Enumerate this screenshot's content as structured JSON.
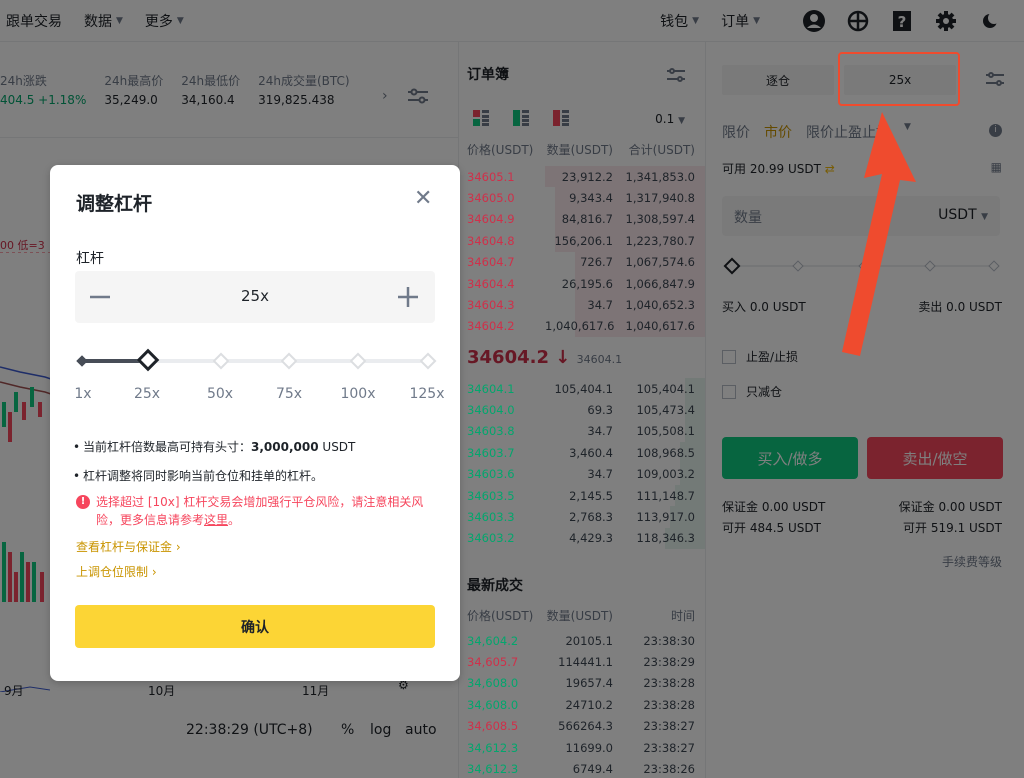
{
  "nav": {
    "left": [
      "跟单交易",
      "数据",
      "更多"
    ],
    "right": [
      "钱包",
      "订单"
    ]
  },
  "ticker": {
    "items": [
      {
        "label": "24h涨跌",
        "value": "404.5 +1.18%"
      },
      {
        "label": "24h最高价",
        "value": "35,249.0"
      },
      {
        "label": "24h最低价",
        "value": "34,160.4"
      },
      {
        "label": "24h成交量(BTC)",
        "value": "319,825.438"
      }
    ]
  },
  "chart": {
    "months": [
      "9月",
      "10月",
      "11月"
    ],
    "time": "22:38:29 (UTC+8)",
    "opts": [
      "%",
      "log",
      "auto"
    ],
    "low_label": "00 低=3"
  },
  "orderbook": {
    "title": "订单簿",
    "precision": "0.1",
    "headers": [
      "价格(USDT)",
      "数量(USDT)",
      "合计(USDT)"
    ],
    "asks": [
      [
        "34605.1",
        "23,912.2",
        "1,341,853.0"
      ],
      [
        "34605.0",
        "9,343.4",
        "1,317,940.8"
      ],
      [
        "34604.9",
        "84,816.7",
        "1,308,597.4"
      ],
      [
        "34604.8",
        "156,206.1",
        "1,223,780.7"
      ],
      [
        "34604.7",
        "726.7",
        "1,067,574.6"
      ],
      [
        "34604.4",
        "26,195.6",
        "1,066,847.9"
      ],
      [
        "34604.3",
        "34.7",
        "1,040,652.3"
      ],
      [
        "34604.2",
        "1,040,617.6",
        "1,040,617.6"
      ]
    ],
    "last_price": "34604.2",
    "last_sub": "34604.1",
    "bids": [
      [
        "34604.1",
        "105,404.1",
        "105,404.1"
      ],
      [
        "34604.0",
        "69.3",
        "105,473.4"
      ],
      [
        "34603.8",
        "34.7",
        "105,508.1"
      ],
      [
        "34603.7",
        "3,460.4",
        "108,968.5"
      ],
      [
        "34603.6",
        "34.7",
        "109,003.2"
      ],
      [
        "34603.5",
        "2,145.5",
        "111,148.7"
      ],
      [
        "34603.3",
        "2,768.3",
        "113,917.0"
      ],
      [
        "34603.2",
        "4,429.3",
        "118,346.3"
      ]
    ]
  },
  "trades": {
    "title": "最新成交",
    "headers": [
      "价格(USDT)",
      "数量(USDT)",
      "时间"
    ],
    "rows": [
      [
        "34,604.2",
        "20105.1",
        "23:38:30",
        "g"
      ],
      [
        "34,605.7",
        "114441.1",
        "23:38:29",
        "r"
      ],
      [
        "34,608.0",
        "19657.4",
        "23:38:28",
        "g"
      ],
      [
        "34,608.0",
        "24710.2",
        "23:38:28",
        "g"
      ],
      [
        "34,608.5",
        "566264.3",
        "23:38:27",
        "r"
      ],
      [
        "34,612.3",
        "11699.0",
        "23:38:27",
        "g"
      ],
      [
        "34,612.3",
        "6749.4",
        "23:38:26",
        "g"
      ]
    ]
  },
  "trade_panel": {
    "margin_mode": "逐仓",
    "leverage": "25x",
    "order_types": [
      "限价",
      "市价",
      "限价止盈止损"
    ],
    "available": "可用 20.99 USDT",
    "qty_label": "数量",
    "qty_unit": "USDT",
    "buy_amount": "买入 0.0 USDT",
    "sell_amount": "卖出 0.0 USDT",
    "tpsl": "止盈/止损",
    "reduce_only": "只减仓",
    "buy_btn": "买入/做多",
    "sell_btn": "卖出/做空",
    "margin_buy": "保证金 0.00 USDT",
    "margin_sell": "保证金 0.00 USDT",
    "open_buy": "可开 484.5 USDT",
    "open_sell": "可开 519.1 USDT",
    "fee": "手续费等级"
  },
  "modal": {
    "title": "调整杠杆",
    "leverage_label": "杠杆",
    "value": "25x",
    "ticks": [
      "1x",
      "25x",
      "50x",
      "75x",
      "100x",
      "125x"
    ],
    "slider_value": 25,
    "slider_max": 125,
    "bullet1_prefix": "当前杠杆倍数最高可持有头寸：",
    "bullet1_value": "3,000,000",
    "bullet1_unit": " USDT",
    "bullet2": "杠杆调整将同时影响当前仓位和挂单的杠杆。",
    "warning": "选择超过 [10x] 杠杆交易会增加强行平仓风险，请注意相关风险，更多信息请参考",
    "warning_link": "这里",
    "warning_end": "。",
    "link1": "查看杠杆与保证金 ›",
    "link2": "上调仓位限制 ›",
    "confirm": "确认"
  },
  "colors": {
    "accent": "#fcd535",
    "buy": "#0ecb81",
    "sell": "#f6465d",
    "annotation": "#ef4b2e"
  }
}
